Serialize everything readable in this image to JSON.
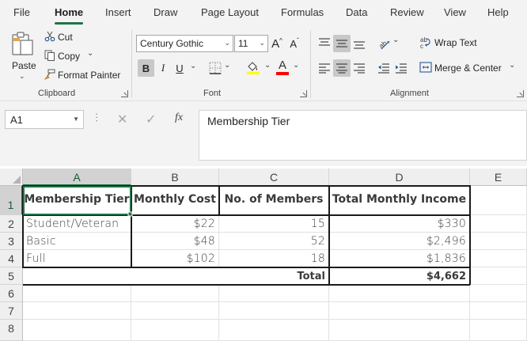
{
  "menu": {
    "tabs": [
      {
        "label": "File"
      },
      {
        "label": "Home"
      },
      {
        "label": "Insert"
      },
      {
        "label": "Draw"
      },
      {
        "label": "Page Layout"
      },
      {
        "label": "Formulas"
      },
      {
        "label": "Data"
      },
      {
        "label": "Review"
      },
      {
        "label": "View"
      },
      {
        "label": "Help"
      }
    ],
    "active": "Home"
  },
  "ribbon": {
    "clipboard": {
      "paste_label": "Paste",
      "cut_label": "Cut",
      "copy_label": "Copy",
      "format_painter_label": "Format Painter",
      "group_label": "Clipboard"
    },
    "font": {
      "font_name": "Century Gothic",
      "font_size": "11",
      "grow_label": "A",
      "shrink_label": "A",
      "bold_label": "B",
      "italic_label": "I",
      "underline_label": "U",
      "font_color_label": "A",
      "group_label": "Font",
      "fill_color": "#ffff00",
      "font_color": "#ff0000"
    },
    "alignment": {
      "wrap_text_label": "Wrap Text",
      "merge_center_label": "Merge & Center",
      "group_label": "Alignment"
    }
  },
  "formula_bar": {
    "name_box": "A1",
    "fx_label": "fx",
    "content": "Membership Tier"
  },
  "sheet": {
    "columns": [
      "A",
      "B",
      "C",
      "D",
      "E"
    ],
    "rows": [
      "1",
      "2",
      "3",
      "4",
      "5",
      "6",
      "7",
      "8"
    ],
    "selected_cell": "A1",
    "header": [
      "Membership Tier",
      "Monthly Cost",
      "No. of Members",
      "Total Monthly Income"
    ],
    "data": [
      [
        "Student/Veteran",
        "$22",
        "15",
        "$330"
      ],
      [
        "Basic",
        "$48",
        "52",
        "$2,496"
      ],
      [
        "Full",
        "$102",
        "18",
        "$1,836"
      ]
    ],
    "total_label": "Total",
    "total_value": "$4,662"
  },
  "colors": {
    "accent": "#217346",
    "ribbon_bg": "#f3f3f3",
    "header_bg": "#efefef"
  }
}
